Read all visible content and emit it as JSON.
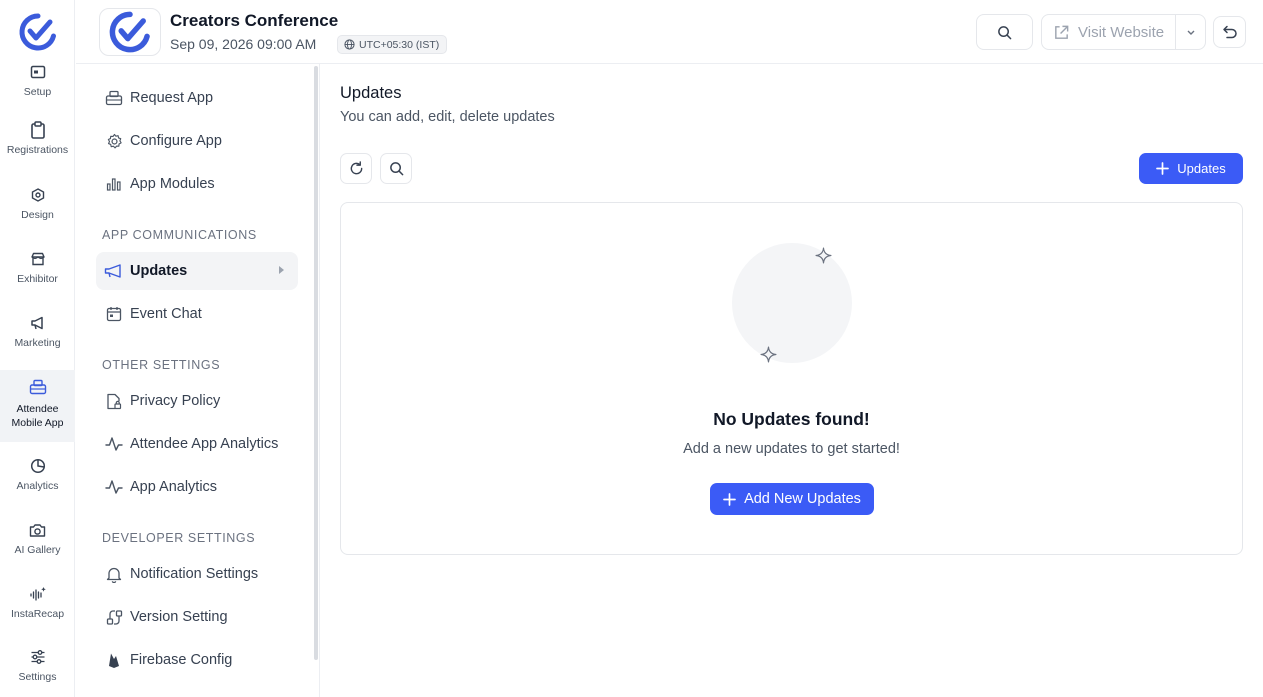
{
  "rail": {
    "items": [
      {
        "label": "Setup",
        "icon": "setup-icon"
      },
      {
        "label": "Registrations",
        "icon": "clipboard-icon"
      },
      {
        "label": "Design",
        "icon": "design-icon"
      },
      {
        "label": "Exhibitor",
        "icon": "storefront-icon"
      },
      {
        "label": "Marketing",
        "icon": "megaphone-icon"
      },
      {
        "label_line1": "Attendee",
        "label_line2": "Mobile App",
        "icon": "mobile-app-icon",
        "active": true
      },
      {
        "label": "Analytics",
        "icon": "pie-chart-icon"
      },
      {
        "label": "AI Gallery",
        "icon": "camera-icon"
      },
      {
        "label": "InstaRecap",
        "icon": "instarecap-icon"
      },
      {
        "label": "Settings",
        "icon": "sliders-icon"
      }
    ]
  },
  "header": {
    "event_title": "Creators Conference",
    "event_date": "Sep 09, 2026 09:00 AM",
    "timezone": "UTC+05:30 (IST)",
    "visit_website_label": "Visit Website"
  },
  "sidebar": {
    "items_top": [
      {
        "label": "Request App",
        "icon": "request-app-icon"
      },
      {
        "label": "Configure App",
        "icon": "gear-icon"
      },
      {
        "label": "App Modules",
        "icon": "bar-chart-icon"
      }
    ],
    "section_communications": "APP COMMUNICATIONS",
    "items_communications": [
      {
        "label": "Updates",
        "icon": "megaphone-icon",
        "active": true
      },
      {
        "label": "Event Chat",
        "icon": "calendar-icon"
      }
    ],
    "section_other": "OTHER SETTINGS",
    "items_other": [
      {
        "label": "Privacy Policy",
        "icon": "privacy-file-icon"
      },
      {
        "label": "Attendee App Analytics",
        "icon": "activity-icon"
      },
      {
        "label": "App Analytics",
        "icon": "activity-icon"
      }
    ],
    "section_developer": "DEVELOPER SETTINGS",
    "items_developer": [
      {
        "label": "Notification Settings",
        "icon": "bell-icon"
      },
      {
        "label": "Version Setting",
        "icon": "version-icon"
      },
      {
        "label": "Firebase Config",
        "icon": "firebase-icon"
      }
    ]
  },
  "main": {
    "title": "Updates",
    "subtitle": "You can add, edit, delete updates",
    "add_button_label": "Updates",
    "empty_title": "No Updates found!",
    "empty_subtitle": "Add a new updates to get started!",
    "empty_cta_label": "Add New Updates"
  },
  "colors": {
    "primary": "#3b5bf6",
    "brand": "#3b5bdb"
  }
}
